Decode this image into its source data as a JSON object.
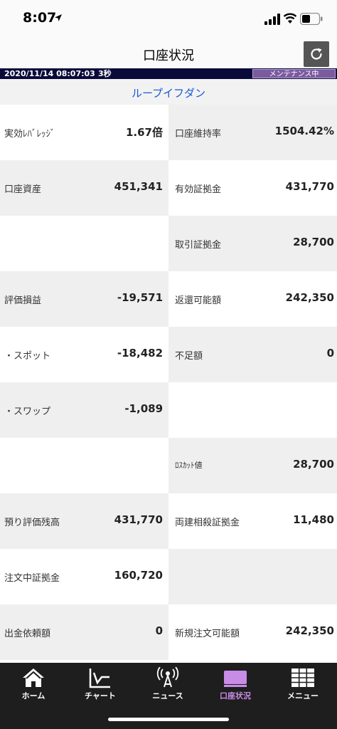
{
  "status_bar": {
    "time": "8:07",
    "icons": [
      "location-arrow-icon",
      "cellular-signal-icon",
      "wifi-icon",
      "battery-icon"
    ]
  },
  "header": {
    "title": "口座状況",
    "refresh_icon": "refresh-icon"
  },
  "info_bar": {
    "datetime": "2020/11/14 08:07:03",
    "interval": "3秒",
    "maintenance": "メンテナンス中"
  },
  "link": {
    "label": "ループイフダン"
  },
  "rows": [
    {
      "left": {
        "label": "実効ﾚﾊﾞﾚｯｼﾞ",
        "value": "1.67倍"
      },
      "right": {
        "label": "口座維持率",
        "value": "1504.42%"
      }
    },
    {
      "left": {
        "label": "口座資産",
        "value": "451,341"
      },
      "right": {
        "label": "有効証拠金",
        "value": "431,770"
      }
    },
    {
      "left": {
        "label": "",
        "value": ""
      },
      "right": {
        "label": "取引証拠金",
        "value": "28,700"
      }
    },
    {
      "left": {
        "label": "評価損益",
        "value": "-19,571"
      },
      "right": {
        "label": "返還可能額",
        "value": "242,350"
      }
    },
    {
      "left": {
        "label": "・スポット",
        "value": "-18,482"
      },
      "right": {
        "label": "不足額",
        "value": "0"
      }
    },
    {
      "left": {
        "label": "・スワップ",
        "value": "-1,089"
      },
      "right": {
        "label": "",
        "value": ""
      }
    },
    {
      "left": {
        "label": "",
        "value": ""
      },
      "right": {
        "label": "ﾛｽｶｯﾄ値",
        "value": "28,700"
      }
    },
    {
      "left": {
        "label": "預り評価残高",
        "value": "431,770"
      },
      "right": {
        "label": "両建相殺証拠金",
        "value": "11,480"
      }
    },
    {
      "left": {
        "label": "注文中証拠金",
        "value": "160,720"
      },
      "right": {
        "label": "",
        "value": ""
      }
    },
    {
      "left": {
        "label": "出金依頼額",
        "value": "0"
      },
      "right": {
        "label": "新規注文可能額",
        "value": "242,350"
      }
    }
  ],
  "tabs": [
    {
      "label": "ホーム",
      "icon": "home-icon"
    },
    {
      "label": "チャート",
      "icon": "chart-icon"
    },
    {
      "label": "ニュース",
      "icon": "news-broadcast-icon"
    },
    {
      "label": "口座状況",
      "icon": "account-status-icon",
      "active": true
    },
    {
      "label": "メニュー",
      "icon": "menu-grid-icon"
    }
  ],
  "colors": {
    "active_tab": "#c88be6",
    "link": "#1a57d6",
    "info_bar": "#0a0a3a",
    "maintenance_badge": "#7b5aa0",
    "tabbar": "#1e1e1e"
  }
}
